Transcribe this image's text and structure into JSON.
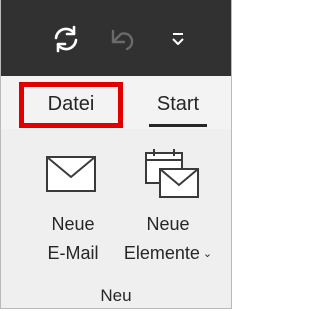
{
  "quick_access_toolbar": {
    "sync_icon": "sync-icon",
    "undo_icon": "undo-icon",
    "customize_icon": "customize-toolbar-icon"
  },
  "tabs": [
    {
      "label": "Datei",
      "highlighted": true,
      "highlight_color": "#e00000"
    },
    {
      "label": "Start",
      "selected": true
    }
  ],
  "group": {
    "title": "Neu",
    "buttons": [
      {
        "line1": "Neue",
        "line2": "E-Mail",
        "icon": "envelope-icon"
      },
      {
        "line1": "Neue",
        "line2": "Elemente",
        "icon": "calendar-envelope-icon",
        "has_dropdown": true
      }
    ]
  },
  "colors": {
    "toolbar_bg": "#313131",
    "ribbon_bg": "#efefef",
    "text": "#262626",
    "disabled_icon": "#6a6a6a"
  }
}
